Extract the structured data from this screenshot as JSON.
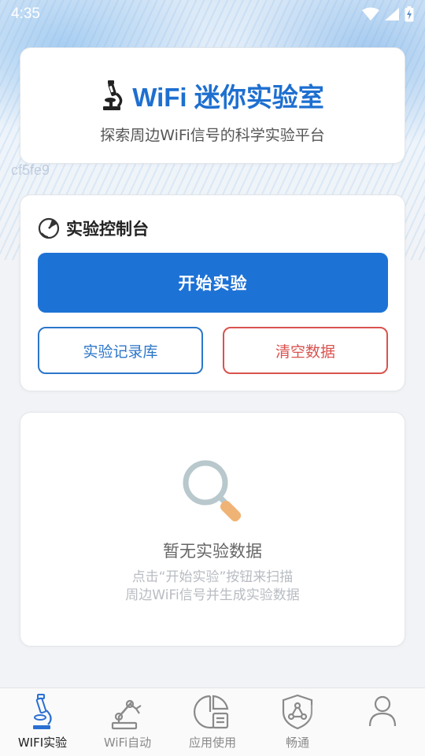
{
  "status_bar": {
    "time": "4:35",
    "icons": [
      "wifi-icon",
      "cellular-icon",
      "battery-charging-icon"
    ]
  },
  "header": {
    "title": "WiFi 迷你实验室",
    "subtitle": "探索周边WiFi信号的科学实验平台",
    "icon": "microscope-icon"
  },
  "watermark": "cf5fe9",
  "control_panel": {
    "title": "实验控制台",
    "icon": "radar-icon",
    "start_button": "开始实验",
    "records_button": "实验记录库",
    "clear_button": "清空数据"
  },
  "empty_state": {
    "icon": "magnifier-icon",
    "title": "暂无实验数据",
    "hint_line1": "点击“开始实验”按钮来扫描",
    "hint_line2": "周边WiFi信号并生成实验数据"
  },
  "bottom_nav": {
    "items": [
      {
        "label": "WIFI实验",
        "icon": "microscope-icon",
        "active": true
      },
      {
        "label": "WiFi自动",
        "icon": "robot-arm-icon",
        "active": false
      },
      {
        "label": "应用使用",
        "icon": "pie-chart-doc-icon",
        "active": false
      },
      {
        "label": "畅通",
        "icon": "shield-network-icon",
        "active": false
      },
      {
        "label": "",
        "icon": "user-icon",
        "active": false
      }
    ]
  },
  "colors": {
    "primary": "#1d72d6",
    "danger": "#d9534f",
    "background": "#f1f3f6"
  }
}
